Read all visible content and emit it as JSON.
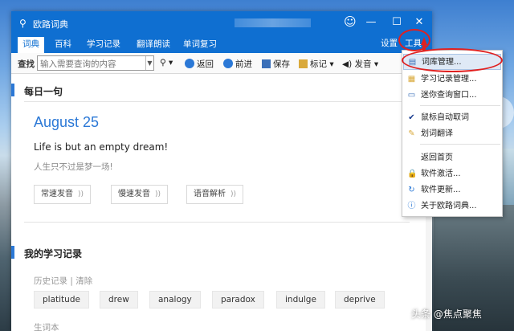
{
  "window": {
    "title": "欧路词典",
    "controls": {
      "minimize": "—",
      "maximize": "☐",
      "close": "✕"
    }
  },
  "tabs": [
    "词典",
    "百科",
    "学习记录",
    "翻译朗读",
    "单词复习"
  ],
  "tabs_right": {
    "settings": "设置",
    "tools": "工具"
  },
  "toolbar": {
    "search_label": "查找",
    "search_placeholder": "输入需要查询的内容",
    "back": "返回",
    "forward": "前进",
    "save": "保存",
    "mark": "标记",
    "speak": "发音"
  },
  "daily": {
    "title": "每日一句",
    "date": "August 25",
    "sentence_en": "Life is but an empty dream!",
    "sentence_zh": "人生只不过是梦一场!",
    "buttons": [
      "常速发音",
      "慢速发音",
      "语音解析"
    ]
  },
  "records": {
    "title": "我的学习记录",
    "history_label": "历史记录 | 清除",
    "words": [
      "platitude",
      "drew",
      "analogy",
      "paradox",
      "indulge",
      "deprive"
    ],
    "vocab_label": "生词本"
  },
  "menu": {
    "items": [
      "词库管理...",
      "学习记录管理...",
      "迷你查询窗口...",
      "鼠标自动取词",
      "划词翻译",
      "返回首页",
      "软件激活...",
      "软件更新...",
      "关于欧路词典..."
    ]
  },
  "watermark": "头条 @焦点聚焦",
  "colors": {
    "accent": "#0f6fd1",
    "annotation": "#e02020"
  }
}
